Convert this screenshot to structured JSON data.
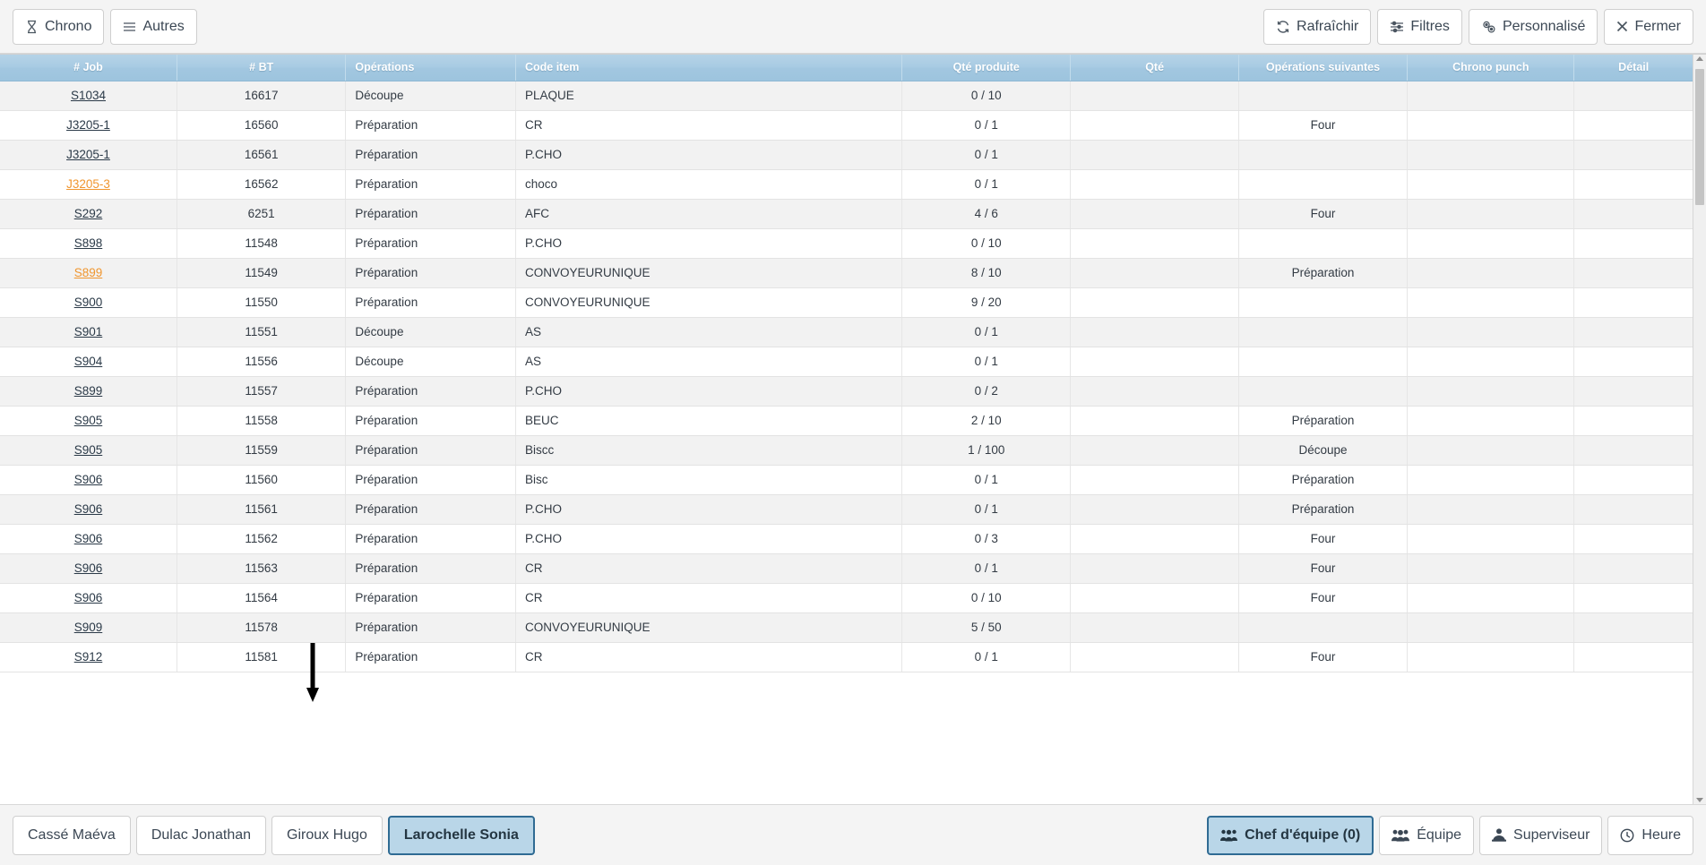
{
  "toolbar": {
    "left_buttons": [
      {
        "label": "Chrono",
        "icon": "hourglass-icon"
      },
      {
        "label": "Autres",
        "icon": "menu-icon"
      }
    ],
    "right_buttons": [
      {
        "label": "Rafraîchir",
        "icon": "refresh-icon"
      },
      {
        "label": "Filtres",
        "icon": "filter-sliders-icon"
      },
      {
        "label": "Personnalisé",
        "icon": "gears-icon"
      },
      {
        "label": "Fermer",
        "icon": "close-icon"
      }
    ]
  },
  "table": {
    "columns": [
      {
        "key": "job",
        "label": "# Job"
      },
      {
        "key": "bt",
        "label": "# BT"
      },
      {
        "key": "op",
        "label": "Opérations"
      },
      {
        "key": "item",
        "label": "Code item"
      },
      {
        "key": "qte_produite",
        "label": "Qté produite"
      },
      {
        "key": "qte",
        "label": "Qté"
      },
      {
        "key": "op_suivantes",
        "label": "Opérations suivantes"
      },
      {
        "key": "chrono_punch",
        "label": "Chrono punch"
      },
      {
        "key": "detail",
        "label": "Détail"
      }
    ],
    "rows": [
      {
        "job": "S1034",
        "bt": "16617",
        "op": "Découpe",
        "item": "PLAQUE",
        "qte_produite": "0 / 10",
        "qte": "",
        "op_suivantes": "",
        "chrono_punch": "",
        "detail": "",
        "highlight": false
      },
      {
        "job": "J3205-1",
        "bt": "16560",
        "op": "Préparation",
        "item": "CR",
        "qte_produite": "0 / 1",
        "qte": "",
        "op_suivantes": "Four",
        "chrono_punch": "",
        "detail": "",
        "highlight": false
      },
      {
        "job": "J3205-1",
        "bt": "16561",
        "op": "Préparation",
        "item": "P.CHO",
        "qte_produite": "0 / 1",
        "qte": "",
        "op_suivantes": "",
        "chrono_punch": "",
        "detail": "",
        "highlight": false
      },
      {
        "job": "J3205-3",
        "bt": "16562",
        "op": "Préparation",
        "item": "choco",
        "qte_produite": "0 / 1",
        "qte": "",
        "op_suivantes": "",
        "chrono_punch": "",
        "detail": "",
        "highlight": true
      },
      {
        "job": "S292",
        "bt": "6251",
        "op": "Préparation",
        "item": "AFC",
        "qte_produite": "4 / 6",
        "qte": "",
        "op_suivantes": "Four",
        "chrono_punch": "",
        "detail": "",
        "highlight": false
      },
      {
        "job": "S898",
        "bt": "11548",
        "op": "Préparation",
        "item": "P.CHO",
        "qte_produite": "0 / 10",
        "qte": "",
        "op_suivantes": "",
        "chrono_punch": "",
        "detail": "",
        "highlight": false
      },
      {
        "job": "S899",
        "bt": "11549",
        "op": "Préparation",
        "item": "CONVOYEURUNIQUE",
        "qte_produite": "8 / 10",
        "qte": "",
        "op_suivantes": "Préparation",
        "chrono_punch": "",
        "detail": "",
        "highlight": true
      },
      {
        "job": "S900",
        "bt": "11550",
        "op": "Préparation",
        "item": "CONVOYEURUNIQUE",
        "qte_produite": "9 / 20",
        "qte": "",
        "op_suivantes": "",
        "chrono_punch": "",
        "detail": "",
        "highlight": false
      },
      {
        "job": "S901",
        "bt": "11551",
        "op": "Découpe",
        "item": "AS",
        "qte_produite": "0 / 1",
        "qte": "",
        "op_suivantes": "",
        "chrono_punch": "",
        "detail": "",
        "highlight": false
      },
      {
        "job": "S904",
        "bt": "11556",
        "op": "Découpe",
        "item": "AS",
        "qte_produite": "0 / 1",
        "qte": "",
        "op_suivantes": "",
        "chrono_punch": "",
        "detail": "",
        "highlight": false
      },
      {
        "job": "S899",
        "bt": "11557",
        "op": "Préparation",
        "item": "P.CHO",
        "qte_produite": "0 / 2",
        "qte": "",
        "op_suivantes": "",
        "chrono_punch": "",
        "detail": "",
        "highlight": false
      },
      {
        "job": "S905",
        "bt": "11558",
        "op": "Préparation",
        "item": "BEUC",
        "qte_produite": "2 / 10",
        "qte": "",
        "op_suivantes": "Préparation",
        "chrono_punch": "",
        "detail": "",
        "highlight": false
      },
      {
        "job": "S905",
        "bt": "11559",
        "op": "Préparation",
        "item": "Biscc",
        "qte_produite": "1 / 100",
        "qte": "",
        "op_suivantes": "Découpe",
        "chrono_punch": "",
        "detail": "",
        "highlight": false
      },
      {
        "job": "S906",
        "bt": "11560",
        "op": "Préparation",
        "item": "Bisc",
        "qte_produite": "0 / 1",
        "qte": "",
        "op_suivantes": "Préparation",
        "chrono_punch": "",
        "detail": "",
        "highlight": false
      },
      {
        "job": "S906",
        "bt": "11561",
        "op": "Préparation",
        "item": "P.CHO",
        "qte_produite": "0 / 1",
        "qte": "",
        "op_suivantes": "Préparation",
        "chrono_punch": "",
        "detail": "",
        "highlight": false
      },
      {
        "job": "S906",
        "bt": "11562",
        "op": "Préparation",
        "item": "P.CHO",
        "qte_produite": "0 / 3",
        "qte": "",
        "op_suivantes": "Four",
        "chrono_punch": "",
        "detail": "",
        "highlight": false
      },
      {
        "job": "S906",
        "bt": "11563",
        "op": "Préparation",
        "item": "CR",
        "qte_produite": "0 / 1",
        "qte": "",
        "op_suivantes": "Four",
        "chrono_punch": "",
        "detail": "",
        "highlight": false
      },
      {
        "job": "S906",
        "bt": "11564",
        "op": "Préparation",
        "item": "CR",
        "qte_produite": "0 / 10",
        "qte": "",
        "op_suivantes": "Four",
        "chrono_punch": "",
        "detail": "",
        "highlight": false
      },
      {
        "job": "S909",
        "bt": "11578",
        "op": "Préparation",
        "item": "CONVOYEURUNIQUE",
        "qte_produite": "5 / 50",
        "qte": "",
        "op_suivantes": "",
        "chrono_punch": "",
        "detail": "",
        "highlight": false
      },
      {
        "job": "S912",
        "bt": "11581",
        "op": "Préparation",
        "item": "CR",
        "qte_produite": "0 / 1",
        "qte": "",
        "op_suivantes": "Four",
        "chrono_punch": "",
        "detail": "",
        "highlight": false
      }
    ]
  },
  "bottom": {
    "employees": [
      {
        "label": "Cassé Maéva",
        "active": false
      },
      {
        "label": "Dulac Jonathan",
        "active": false
      },
      {
        "label": "Giroux Hugo",
        "active": false
      },
      {
        "label": "Larochelle Sonia",
        "active": true
      }
    ],
    "actions": [
      {
        "label": "Chef d'équipe (0)",
        "icon": "team-lead-icon",
        "active": true
      },
      {
        "label": "Équipe",
        "icon": "people-icon",
        "active": false
      },
      {
        "label": "Superviseur",
        "icon": "supervisor-icon",
        "active": false
      },
      {
        "label": "Heure",
        "icon": "clock-icon",
        "active": false
      }
    ]
  },
  "colors": {
    "highlight_orange": "#f0962f",
    "header_blue": "#a8cbe3",
    "selected_blue": "#b9d6e8",
    "selected_border": "#2f6b93"
  }
}
